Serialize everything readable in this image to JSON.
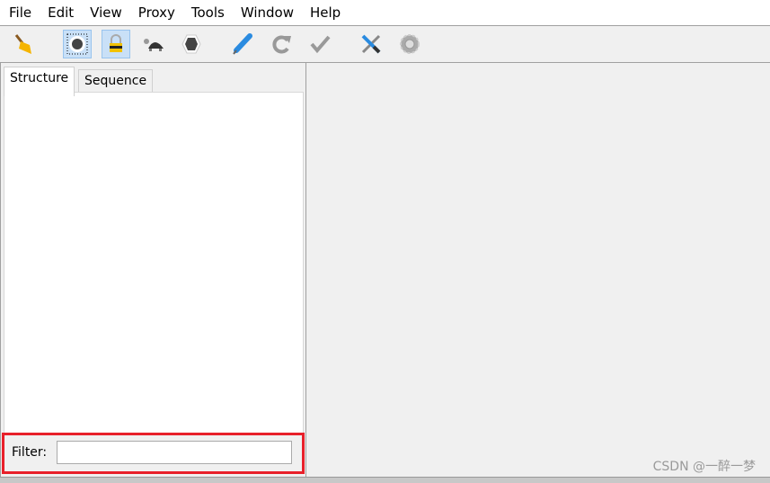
{
  "menu": [
    "File",
    "Edit",
    "View",
    "Proxy",
    "Tools",
    "Window",
    "Help"
  ],
  "toolbar": [
    {
      "icon": "broom-icon",
      "name": "clear-session-button",
      "selected": false
    },
    {
      "icon": "record-icon",
      "name": "record-button",
      "selected": true
    },
    {
      "icon": "ssl-lock-icon",
      "name": "ssl-proxying-button",
      "selected": true
    },
    {
      "icon": "turtle-icon",
      "name": "throttling-button",
      "selected": false
    },
    {
      "icon": "breakpoint-icon",
      "name": "breakpoints-button",
      "selected": false
    },
    {
      "icon": "pen-icon",
      "name": "compose-button",
      "selected": false
    },
    {
      "icon": "repeat-icon",
      "name": "repeat-button",
      "selected": false
    },
    {
      "icon": "check-icon",
      "name": "validate-button",
      "selected": false
    },
    {
      "icon": "tools-icon",
      "name": "tools-button",
      "selected": false
    },
    {
      "icon": "gear-icon",
      "name": "settings-button",
      "selected": false
    }
  ],
  "tabs": [
    "Structure",
    "Sequence"
  ],
  "filter": {
    "label": "Filter:",
    "value": ""
  },
  "watermark": "CSDN @一醉一梦",
  "colors": {
    "highlight_border": "#e8202a",
    "selected_button": "#c9e0f7"
  }
}
